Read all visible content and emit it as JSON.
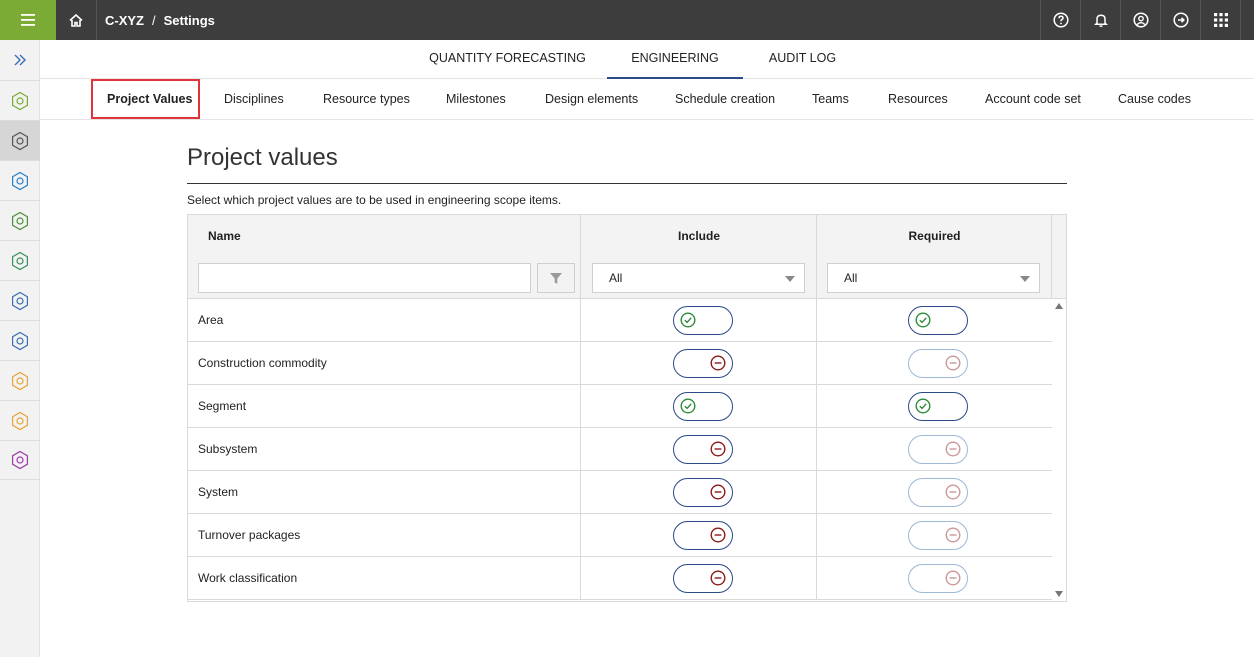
{
  "app": {
    "breadcrumb": {
      "project": "C-XYZ",
      "separator": "/",
      "page": "Settings"
    },
    "menu_icon": "hamburger-icon",
    "home_icon": "home-icon",
    "top_icons": [
      "help-icon",
      "bell-icon",
      "user-icon",
      "logout-icon",
      "apps-grid-icon"
    ],
    "accent_color": "#7cab35"
  },
  "rail": {
    "expand_icon": "double-chevron-right-icon",
    "items": [
      {
        "icon": "module-icon-1",
        "color": "#7cab35"
      },
      {
        "icon": "engineering-icon",
        "color": "#555555"
      },
      {
        "icon": "module-icon-3",
        "color": "#2a7fc9"
      },
      {
        "icon": "module-icon-4",
        "color": "#4c8f3a"
      },
      {
        "icon": "module-icon-5",
        "color": "#3a8f5c"
      },
      {
        "icon": "module-icon-6",
        "color": "#3a6fb0"
      },
      {
        "icon": "module-icon-7",
        "color": "#3a6fb0"
      },
      {
        "icon": "module-icon-8",
        "color": "#e8a23a"
      },
      {
        "icon": "module-icon-9",
        "color": "#e8a23a"
      },
      {
        "icon": "module-icon-10",
        "color": "#9b3aa8"
      }
    ]
  },
  "main_tabs": [
    "QUANTITY FORECASTING",
    "ENGINEERING",
    "AUDIT LOG"
  ],
  "active_main_tab": "ENGINEERING",
  "sub_tabs": [
    "Project Values",
    "Disciplines",
    "Resource types",
    "Milestones",
    "Design elements",
    "Schedule creation",
    "Teams",
    "Resources",
    "Account code set",
    "Cause codes"
  ],
  "active_sub_tab": "Project Values",
  "content": {
    "title": "Project values",
    "subtitle": "Select which project values are to be used in engineering scope items."
  },
  "grid": {
    "columns": {
      "name": "Name",
      "include": "Include",
      "required": "Required"
    },
    "filters": {
      "name_value": "",
      "filter_icon": "filter-icon",
      "include_value": "All",
      "required_value": "All"
    },
    "rows": [
      {
        "name": "Area",
        "include": true,
        "required": true,
        "required_enabled": true
      },
      {
        "name": "Construction commodity",
        "include": false,
        "required": false,
        "required_enabled": false
      },
      {
        "name": "Segment",
        "include": true,
        "required": true,
        "required_enabled": true
      },
      {
        "name": "Subsystem",
        "include": false,
        "required": false,
        "required_enabled": false
      },
      {
        "name": "System",
        "include": false,
        "required": false,
        "required_enabled": false
      },
      {
        "name": "Turnover packages",
        "include": false,
        "required": false,
        "required_enabled": false
      },
      {
        "name": "Work classification",
        "include": false,
        "required": false,
        "required_enabled": false
      }
    ],
    "colors": {
      "on": "#2e8b3a",
      "off": "#8b1a1a",
      "toggle_border": "#2b4a86"
    }
  }
}
